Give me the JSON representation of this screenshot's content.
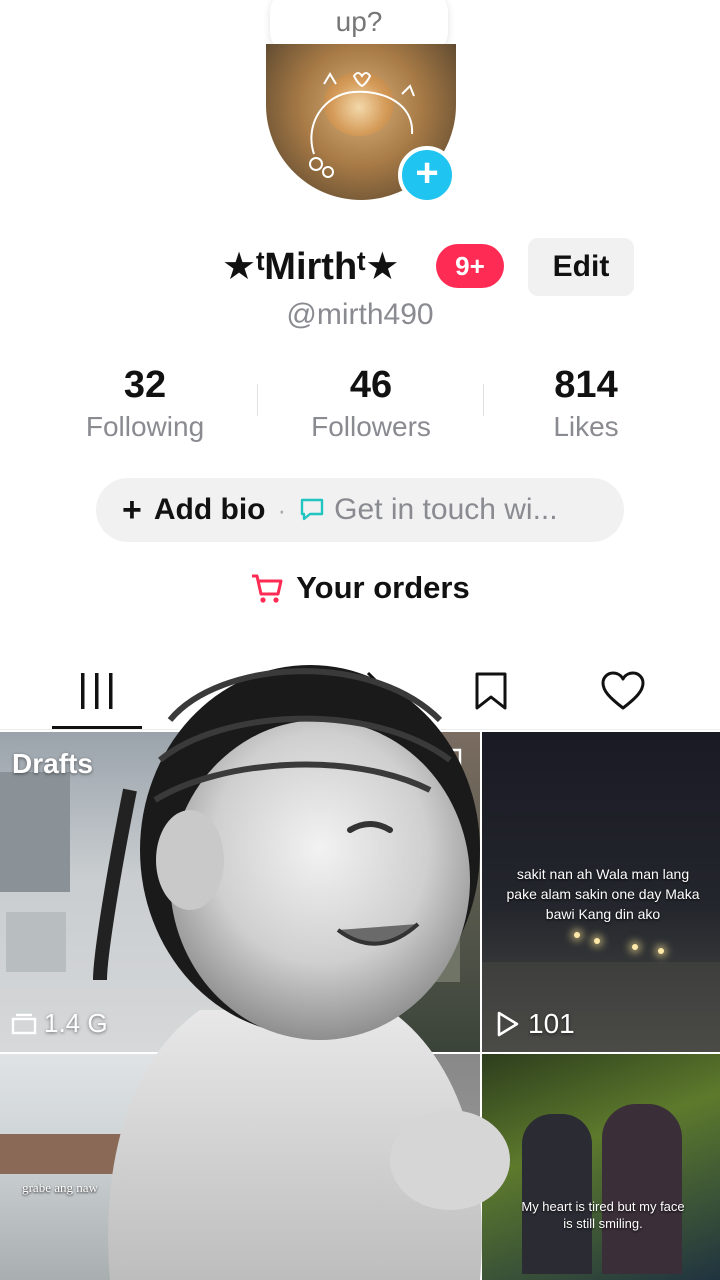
{
  "bubble": {
    "text": "up?"
  },
  "profile": {
    "username": "★ᵗMirthᵗ★",
    "badge": "9+",
    "edit_label": "Edit",
    "handle": "@mirth490"
  },
  "stats": [
    {
      "value": "32",
      "label": "Following"
    },
    {
      "value": "46",
      "label": "Followers"
    },
    {
      "value": "814",
      "label": "Likes"
    }
  ],
  "bio": {
    "plus": "+",
    "add_bio": "Add bio",
    "separator": "·",
    "contact": "Get in touch wi..."
  },
  "orders": {
    "label": "Your orders"
  },
  "tabs": [
    "videos-grid",
    "reposts",
    "favorites",
    "liked"
  ],
  "grid": {
    "drafts_label": "Drafts",
    "drafts_count": "1.4 G",
    "cell3_caption": "sakit nan ah Wala man lang pake alam sakin one day Maka bawi Kang din ako",
    "cell3_views": "101",
    "cell4_caption": "grabe ang naw",
    "cell6_caption": "My heart is tired but my face is still smiling."
  },
  "colors": {
    "accent_red": "#fe2c55",
    "plus_blue": "#20c4f0",
    "cart_red": "#fe2c55",
    "contact_teal": "#20c4c0"
  }
}
